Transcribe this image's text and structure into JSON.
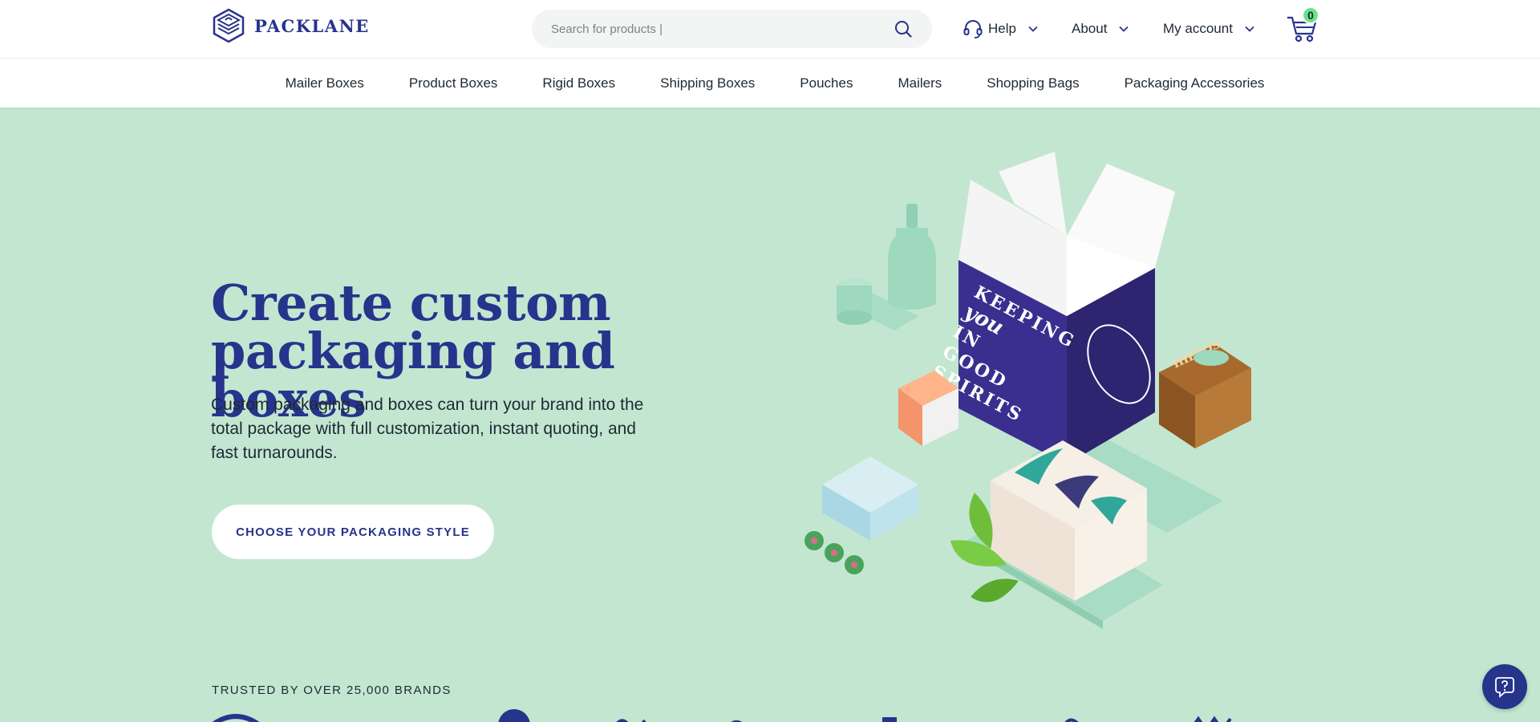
{
  "header": {
    "logo_text": "PACKLANE",
    "search": {
      "placeholder": "Search for products |"
    },
    "nav": [
      {
        "label": "Help"
      },
      {
        "label": "About"
      },
      {
        "label": "My account"
      }
    ],
    "cart": {
      "count": "0"
    }
  },
  "categories": [
    "Mailer Boxes",
    "Product Boxes",
    "Rigid Boxes",
    "Shipping Boxes",
    "Pouches",
    "Mailers",
    "Shopping Bags",
    "Packaging Accessories"
  ],
  "hero": {
    "title_line1": "Create custom",
    "title_line2": "packaging and boxes",
    "subtitle": "Custom packaging and boxes can turn your brand into the total package with full customization, instant quoting, and fast turnarounds.",
    "cta_label": "CHOOSE YOUR PACKAGING STYLE",
    "box_text": [
      "KEEPING",
      "you",
      "IN",
      "GOOD",
      "SPIRITS"
    ],
    "wood_box_text": "HIPPOS"
  },
  "trusted": {
    "label": "TRUSTED BY OVER 25,000 BRANDS"
  },
  "colors": {
    "brand": "#27348b",
    "hero_bg": "#c3e6d1",
    "badge": "#6be28a",
    "mint": "#9ed8bd"
  },
  "icons": [
    "logo-icon",
    "search-icon",
    "headset-icon",
    "chevron-down-icon",
    "cart-icon",
    "help-chat-icon"
  ]
}
